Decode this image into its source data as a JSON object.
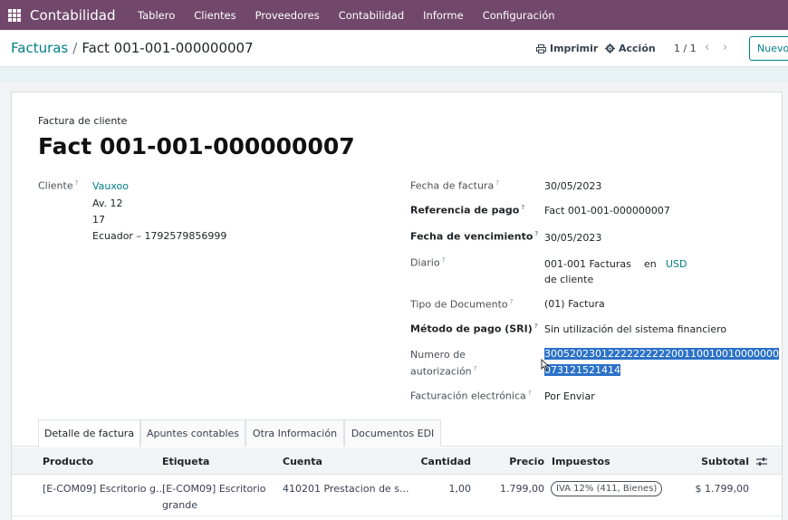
{
  "navbar": {
    "brand": "Contabilidad",
    "menu": [
      "Tablero",
      "Clientes",
      "Proveedores",
      "Contabilidad",
      "Informe",
      "Configuración"
    ]
  },
  "control": {
    "breadcrumb_parent": "Facturas",
    "breadcrumb_sep": "/",
    "breadcrumb_current": "Fact 001-001-000000007",
    "print_label": "Imprimir",
    "action_label": "Acción",
    "pager": "1 / 1",
    "new_label": "Nuevo"
  },
  "form": {
    "subtitle": "Factura de cliente",
    "title": "Fact 001-001-000000007",
    "help_mark": "?",
    "customer": {
      "label": "Cliente",
      "name": "Vauxoo",
      "line1": "Av. 12",
      "line2": "17",
      "line3": "Ecuador – 1792579856999"
    },
    "invoice_date": {
      "label": "Fecha de factura",
      "value": "30/05/2023"
    },
    "payment_ref": {
      "label": "Referencia de pago",
      "value": "Fact 001-001-000000007"
    },
    "due_date": {
      "label": "Fecha de vencimiento",
      "value": "30/05/2023"
    },
    "journal": {
      "label": "Diario",
      "value_line1": "001-001 Facturas",
      "value_line2": "de cliente",
      "in_text": "en",
      "currency": "USD"
    },
    "doc_type": {
      "label": "Tipo de Documento",
      "value": "(01) Factura"
    },
    "payment_method": {
      "label": "Método de pago (SRI)",
      "value": "Sin utilización del sistema financiero"
    },
    "auth_number": {
      "label_line1": "Numero de",
      "label_line2": "autorización",
      "value_line1": "3005202301222222222200110010010000000",
      "value_line2": "073121521414"
    },
    "e_invoicing": {
      "label": "Facturación electrónica",
      "value": "Por Enviar"
    }
  },
  "tabs": [
    "Detalle de factura",
    "Apuntes contables",
    "Otra Información",
    "Documentos EDI"
  ],
  "table": {
    "headers": {
      "product": "Producto",
      "label": "Etiqueta",
      "account": "Cuenta",
      "quantity": "Cantidad",
      "price": "Precio",
      "taxes": "Impuestos",
      "subtotal": "Subtotal"
    },
    "rows": [
      {
        "product": "[E-COM09] Escritorio g...",
        "label_line1": "[E-COM09] Escritorio",
        "label_line2": "grande",
        "account": "410201 Prestacion de s...",
        "quantity": "1,00",
        "price": "1.799,00",
        "tax": "IVA 12% (411, Bienes)",
        "subtotal": "$ 1.799,00"
      }
    ]
  }
}
